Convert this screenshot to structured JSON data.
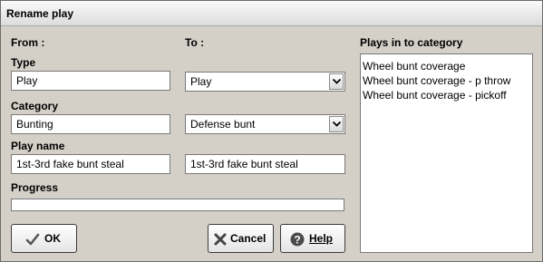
{
  "window": {
    "title": "Rename play"
  },
  "from": {
    "header": "From :",
    "type_label": "Type",
    "type_value": "Play",
    "category_label": "Category",
    "category_value": "Bunting",
    "playname_label": "Play name",
    "playname_value": "1st-3rd fake bunt steal",
    "progress_label": "Progress",
    "progress_value": 0
  },
  "to": {
    "header": "To :",
    "type_value": "Play",
    "category_value": "Defense bunt",
    "playname_value": "1st-3rd fake bunt steal"
  },
  "plays": {
    "header": "Plays in to category",
    "items": [
      "Wheel bunt coverage",
      "Wheel bunt coverage - p throw",
      "Wheel bunt coverage - pickoff"
    ]
  },
  "buttons": {
    "ok": "OK",
    "cancel": "Cancel",
    "help": "Help"
  },
  "icons": {
    "ok": "checkmark-icon",
    "cancel": "x-icon",
    "help": "question-icon",
    "dropdown": "chevron-down-icon"
  }
}
